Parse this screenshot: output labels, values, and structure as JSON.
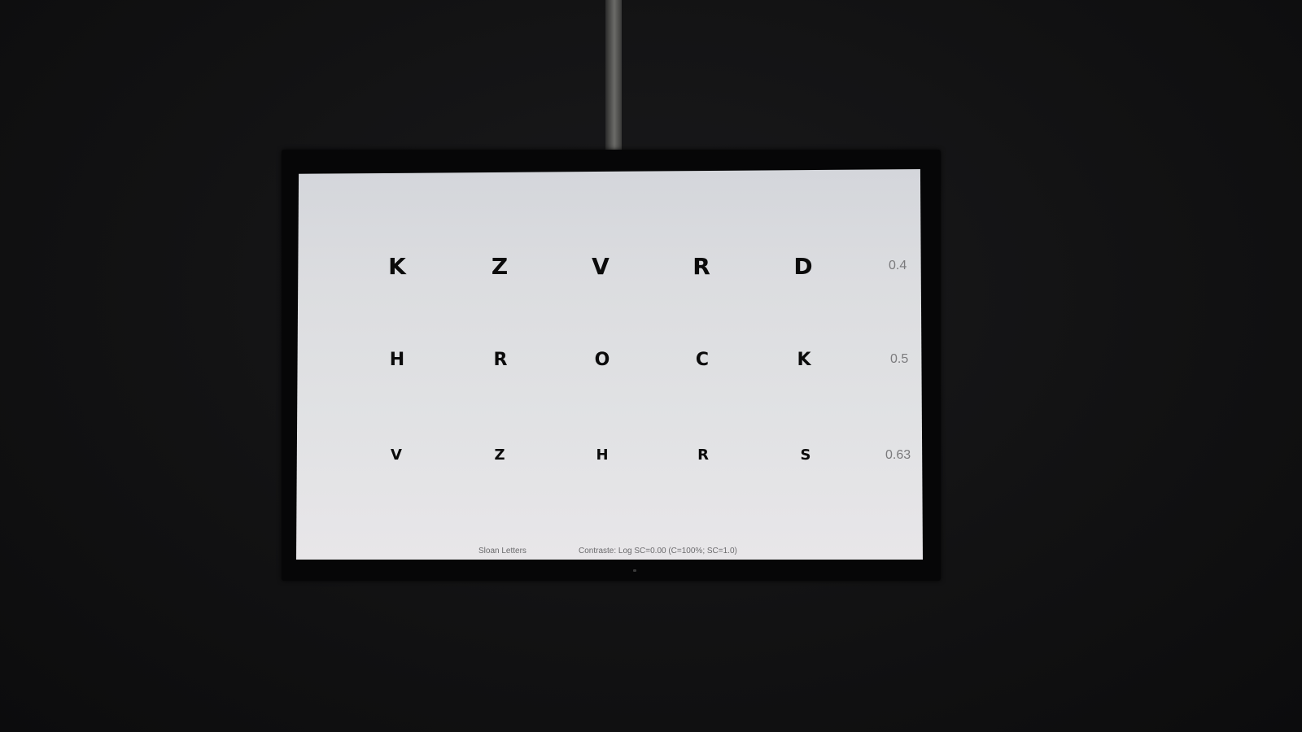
{
  "chart_rows": [
    {
      "letters": [
        "K",
        "Z",
        "V",
        "R",
        "D"
      ],
      "acuity": "0.4"
    },
    {
      "letters": [
        "H",
        "R",
        "O",
        "C",
        "K"
      ],
      "acuity": "0.5"
    },
    {
      "letters": [
        "V",
        "Z",
        "H",
        "R",
        "S"
      ],
      "acuity": "0.63"
    }
  ],
  "footer": {
    "optotype": "Sloan Letters",
    "contrast": "Contraste: Log SC=0.00 (C=100%; SC=1.0)"
  }
}
